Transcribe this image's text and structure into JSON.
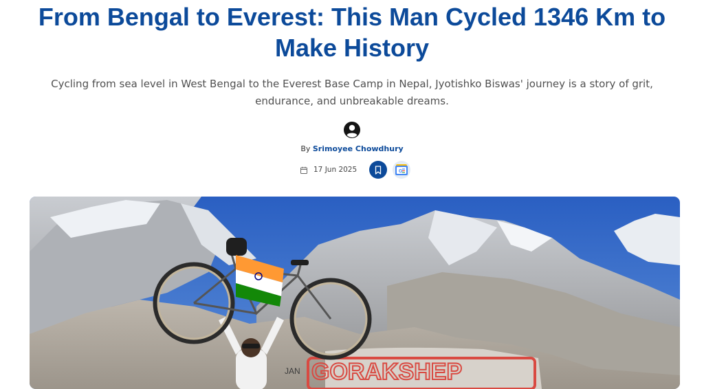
{
  "article": {
    "headline": "From Bengal to Everest: This Man Cycled 1346 Km to Make History",
    "subheadline": "Cycling from sea level in West Bengal to the Everest Base Camp in Nepal, Jyotishko Biswas' journey is a story of grit, endurance, and unbreakable dreams.",
    "byline_prefix": "By",
    "author": "Srimoyee Chowdhury",
    "date": "17 Jun 2025",
    "hero_rock_text_1": "JAN",
    "hero_rock_text_2": "GORAKSHEP"
  },
  "icons": {
    "avatar": "user-circle-icon",
    "calendar": "calendar-icon",
    "bookmark": "bookmark-icon",
    "google_news": "google-news-icon"
  },
  "colors": {
    "headline": "#0c4a9a",
    "author": "#0c4a9a",
    "bookmark_bg": "#0c4a9a",
    "subheadline": "#505050"
  }
}
